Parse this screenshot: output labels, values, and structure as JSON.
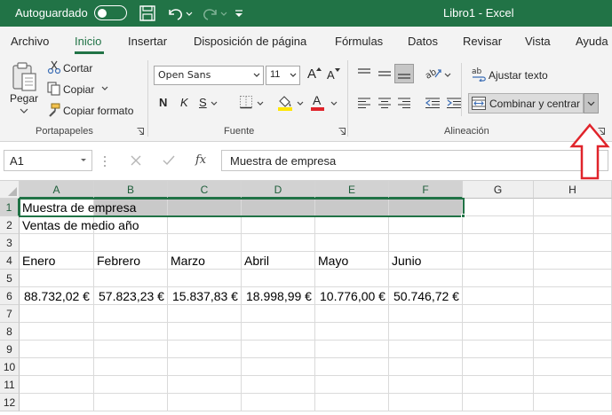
{
  "titlebar": {
    "autosave_label": "Autoguardado",
    "title": "Libro1  -  Excel",
    "background": "#217346"
  },
  "tabs": [
    {
      "label": "Archivo"
    },
    {
      "label": "Inicio",
      "active": true
    },
    {
      "label": "Insertar"
    },
    {
      "label": "Disposición de página"
    },
    {
      "label": "Fórmulas"
    },
    {
      "label": "Datos"
    },
    {
      "label": "Revisar"
    },
    {
      "label": "Vista"
    },
    {
      "label": "Ayuda"
    }
  ],
  "ribbon": {
    "clipboard": {
      "paste_label": "Pegar",
      "cut_label": "Cortar",
      "copy_label": "Copiar",
      "format_painter_label": "Copiar formato",
      "group_label": "Portapapeles"
    },
    "font": {
      "font_name": "Open Sans",
      "font_size": "11",
      "bold_label": "N",
      "italic_label": "K",
      "underline_label": "S",
      "grow_label": "A",
      "shrink_label": "A",
      "font_color_label": "A",
      "group_label": "Fuente"
    },
    "alignment": {
      "wrap_text_label": "Ajustar texto",
      "merge_center_label": "Combinar y centrar",
      "group_label": "Alineación"
    }
  },
  "formula_bar": {
    "name_box": "A1",
    "fx_label": "fx",
    "formula": "Muestra de empresa"
  },
  "sheet": {
    "columns": [
      "A",
      "B",
      "C",
      "D",
      "E",
      "F",
      "G",
      "H"
    ],
    "rows": [
      "1",
      "2",
      "3",
      "4",
      "5",
      "6",
      "7",
      "8",
      "9",
      "10",
      "11",
      "12"
    ],
    "cells": {
      "A1": "Muestra de empresa",
      "A2": "Ventas de medio año",
      "A4": "Enero",
      "B4": "Febrero",
      "C4": "Marzo",
      "D4": "Abril",
      "E4": "Mayo",
      "F4": "Junio",
      "A6": "88.732,02 €",
      "B6": "57.823,23 €",
      "C6": "15.837,83 €",
      "D6": "18.998,99 €",
      "E6": "10.776,00 €",
      "F6": "50.746,72 €"
    },
    "selected_range": "A1:F1"
  },
  "annotation": {
    "arrow_color": "#e0242b",
    "points_to": "merge-center-dropdown-button"
  }
}
